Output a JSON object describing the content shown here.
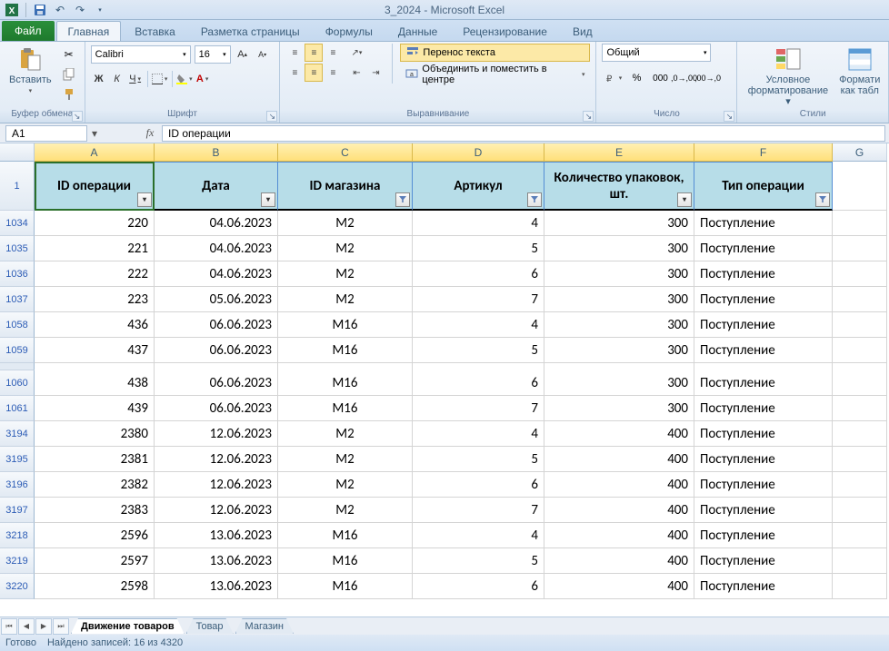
{
  "window": {
    "title": "3_2024 - Microsoft Excel"
  },
  "tabs": {
    "file": "Файл",
    "list": [
      "Главная",
      "Вставка",
      "Разметка страницы",
      "Формулы",
      "Данные",
      "Рецензирование",
      "Вид"
    ],
    "active": 0
  },
  "ribbon": {
    "clipboard": {
      "paste": "Вставить",
      "label": "Буфер обмена"
    },
    "font": {
      "name": "Calibri",
      "size": "16",
      "bold": "Ж",
      "italic": "К",
      "underline": "Ч",
      "label": "Шрифт"
    },
    "alignment": {
      "wrap": "Перенос текста",
      "merge": "Объединить и поместить в центре",
      "label": "Выравнивание"
    },
    "number": {
      "format": "Общий",
      "label": "Число"
    },
    "styles": {
      "cond": "Условное",
      "cond2": "форматирование",
      "fmt": "Формати",
      "fmt2": "как табл",
      "label": "Стили"
    }
  },
  "namebox": "A1",
  "formula": "ID операции",
  "columns": [
    "A",
    "B",
    "C",
    "D",
    "E",
    "F",
    "G"
  ],
  "header_row": "1",
  "headers": {
    "A": "ID операции",
    "B": "Дата",
    "C": "ID магазина",
    "D": "Артикул",
    "E": "Количество упаковок, шт.",
    "F": "Тип операции"
  },
  "filters": {
    "A": false,
    "B": false,
    "C": true,
    "D": true,
    "E": false,
    "F": true
  },
  "rows": [
    {
      "n": "1034",
      "A": "220",
      "B": "04.06.2023",
      "C": "M2",
      "D": "4",
      "E": "300",
      "F": "Поступление"
    },
    {
      "n": "1035",
      "A": "221",
      "B": "04.06.2023",
      "C": "M2",
      "D": "5",
      "E": "300",
      "F": "Поступление"
    },
    {
      "n": "1036",
      "A": "222",
      "B": "04.06.2023",
      "C": "M2",
      "D": "6",
      "E": "300",
      "F": "Поступление"
    },
    {
      "n": "1037",
      "A": "223",
      "B": "05.06.2023",
      "C": "M2",
      "D": "7",
      "E": "300",
      "F": "Поступление"
    },
    {
      "n": "1058",
      "A": "436",
      "B": "06.06.2023",
      "C": "M16",
      "D": "4",
      "E": "300",
      "F": "Поступление"
    },
    {
      "n": "1059",
      "A": "437",
      "B": "06.06.2023",
      "C": "M16",
      "D": "5",
      "E": "300",
      "F": "Поступление"
    },
    {
      "gap": true
    },
    {
      "n": "1060",
      "A": "438",
      "B": "06.06.2023",
      "C": "M16",
      "D": "6",
      "E": "300",
      "F": "Поступление"
    },
    {
      "n": "1061",
      "A": "439",
      "B": "06.06.2023",
      "C": "M16",
      "D": "7",
      "E": "300",
      "F": "Поступление"
    },
    {
      "n": "3194",
      "A": "2380",
      "B": "12.06.2023",
      "C": "M2",
      "D": "4",
      "E": "400",
      "F": "Поступление"
    },
    {
      "n": "3195",
      "A": "2381",
      "B": "12.06.2023",
      "C": "M2",
      "D": "5",
      "E": "400",
      "F": "Поступление"
    },
    {
      "n": "3196",
      "A": "2382",
      "B": "12.06.2023",
      "C": "M2",
      "D": "6",
      "E": "400",
      "F": "Поступление"
    },
    {
      "n": "3197",
      "A": "2383",
      "B": "12.06.2023",
      "C": "M2",
      "D": "7",
      "E": "400",
      "F": "Поступление"
    },
    {
      "n": "3218",
      "A": "2596",
      "B": "13.06.2023",
      "C": "M16",
      "D": "4",
      "E": "400",
      "F": "Поступление"
    },
    {
      "n": "3219",
      "A": "2597",
      "B": "13.06.2023",
      "C": "M16",
      "D": "5",
      "E": "400",
      "F": "Поступление"
    },
    {
      "n": "3220",
      "A": "2598",
      "B": "13.06.2023",
      "C": "M16",
      "D": "6",
      "E": "400",
      "F": "Поступление"
    }
  ],
  "sheet_tabs": [
    "Движение товаров",
    "Товар",
    "Магазин"
  ],
  "active_sheet": 0,
  "status": {
    "ready": "Готово",
    "found": "Найдено записей: 16 из 4320"
  },
  "chart_data": {
    "type": "table",
    "columns": [
      "ID операции",
      "Дата",
      "ID магазина",
      "Артикул",
      "Количество упаковок, шт.",
      "Тип операции"
    ],
    "rows": [
      [
        220,
        "04.06.2023",
        "M2",
        4,
        300,
        "Поступление"
      ],
      [
        221,
        "04.06.2023",
        "M2",
        5,
        300,
        "Поступление"
      ],
      [
        222,
        "04.06.2023",
        "M2",
        6,
        300,
        "Поступление"
      ],
      [
        223,
        "05.06.2023",
        "M2",
        7,
        300,
        "Поступление"
      ],
      [
        436,
        "06.06.2023",
        "M16",
        4,
        300,
        "Поступление"
      ],
      [
        437,
        "06.06.2023",
        "M16",
        5,
        300,
        "Поступление"
      ],
      [
        438,
        "06.06.2023",
        "M16",
        6,
        300,
        "Поступление"
      ],
      [
        439,
        "06.06.2023",
        "M16",
        7,
        300,
        "Поступление"
      ],
      [
        2380,
        "12.06.2023",
        "M2",
        4,
        400,
        "Поступление"
      ],
      [
        2381,
        "12.06.2023",
        "M2",
        5,
        400,
        "Поступление"
      ],
      [
        2382,
        "12.06.2023",
        "M2",
        6,
        400,
        "Поступление"
      ],
      [
        2383,
        "12.06.2023",
        "M2",
        7,
        400,
        "Поступление"
      ],
      [
        2596,
        "13.06.2023",
        "M16",
        4,
        400,
        "Поступление"
      ],
      [
        2597,
        "13.06.2023",
        "M16",
        5,
        400,
        "Поступление"
      ],
      [
        2598,
        "13.06.2023",
        "M16",
        6,
        400,
        "Поступление"
      ]
    ]
  }
}
